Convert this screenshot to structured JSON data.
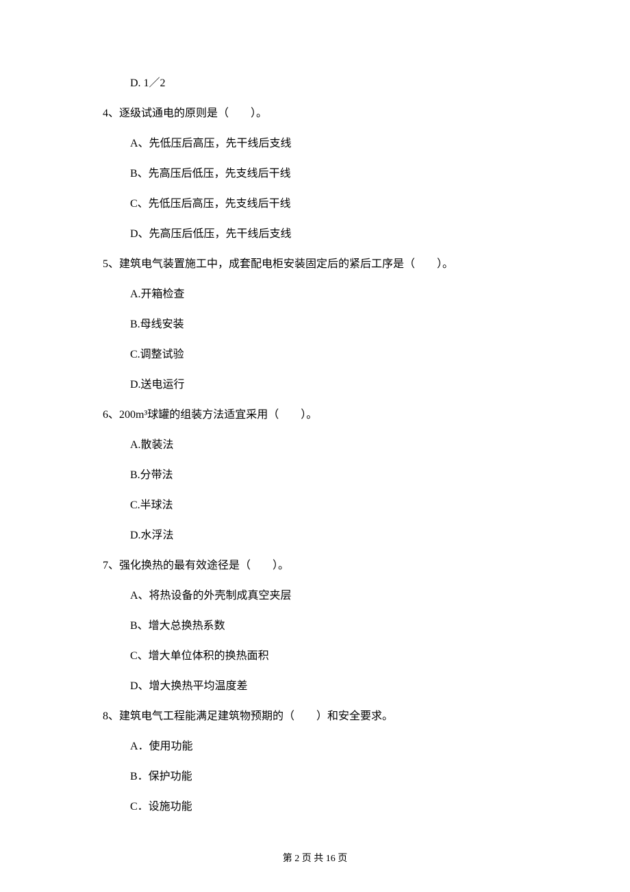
{
  "trailing_option": "D. 1／2",
  "questions": [
    {
      "number": "4、",
      "stem": "逐级试通电的原则是（　　）。",
      "options": [
        "A、先低压后高压，先干线后支线",
        "B、先高压后低压，先支线后干线",
        "C、先低压后高压，先支线后干线",
        "D、先高压后低压，先干线后支线"
      ]
    },
    {
      "number": "5、",
      "stem": "建筑电气装置施工中，成套配电柜安装固定后的紧后工序是（　　）。",
      "options": [
        "A.开箱检查",
        "B.母线安装",
        "C.调整试验",
        "D.送电运行"
      ]
    },
    {
      "number": "6、",
      "stem": "200m³球罐的组装方法适宜采用（　　）。",
      "options": [
        "A.散装法",
        "B.分带法",
        "C.半球法",
        "D.水浮法"
      ]
    },
    {
      "number": "7、",
      "stem": "强化换热的最有效途径是（　　）。",
      "options": [
        "A、将热设备的外壳制成真空夹层",
        "B、增大总换热系数",
        "C、增大单位体积的换热面积",
        "D、增大换热平均温度差"
      ]
    },
    {
      "number": "8、",
      "stem": "建筑电气工程能满足建筑物预期的（　　）和安全要求。",
      "options": [
        "A．使用功能",
        "B．保护功能",
        "C．设施功能"
      ]
    }
  ],
  "footer": "第 2 页 共 16 页"
}
